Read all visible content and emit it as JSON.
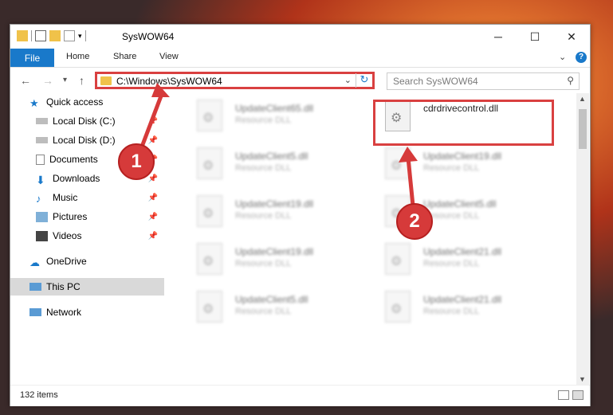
{
  "window": {
    "title": "SysWOW64"
  },
  "ribbon": {
    "file": "File",
    "tabs": [
      "Home",
      "Share",
      "View"
    ],
    "help": "?"
  },
  "nav": {
    "back": "←",
    "forward": "→",
    "recent": "▾",
    "up": "↑"
  },
  "address": {
    "path": "C:\\Windows\\SysWOW64",
    "dropdown": "⌄",
    "refresh": "↻"
  },
  "search": {
    "placeholder": "Search SysWOW64",
    "icon": "search-icon"
  },
  "sidebar": {
    "items": [
      {
        "label": "Quick access",
        "icon": "star-icon"
      },
      {
        "label": "Local Disk (C:)",
        "icon": "drive-icon",
        "pinned": true
      },
      {
        "label": "Local Disk (D:)",
        "icon": "drive-icon",
        "pinned": true
      },
      {
        "label": "Documents",
        "icon": "documents-icon",
        "pinned": true
      },
      {
        "label": "Downloads",
        "icon": "downloads-icon",
        "pinned": true
      },
      {
        "label": "Music",
        "icon": "music-icon",
        "pinned": true
      },
      {
        "label": "Pictures",
        "icon": "pictures-icon",
        "pinned": true
      },
      {
        "label": "Videos",
        "icon": "videos-icon",
        "pinned": true
      },
      {
        "label": "OneDrive",
        "icon": "cloud-icon"
      },
      {
        "label": "This PC",
        "icon": "computer-icon",
        "selected": true
      },
      {
        "label": "Network",
        "icon": "network-icon"
      }
    ]
  },
  "files": {
    "left_column": [
      {
        "name": "UpdateClient65.dll",
        "type": "Resource DLL"
      },
      {
        "name": "UpdateClient5.dll",
        "type": "Resource DLL"
      },
      {
        "name": "UpdateClient19.dll",
        "type": "Resource DLL"
      },
      {
        "name": "UpdateClient19.dll",
        "type": "Resource DLL"
      },
      {
        "name": "UpdateClient5.dll",
        "type": "Resource DLL"
      }
    ],
    "right_column": [
      {
        "name": "cdrdrivecontrol.dll",
        "type": ""
      },
      {
        "name": "UpdateClient19.dll",
        "type": "Resource DLL"
      },
      {
        "name": "UpdateClient5.dll",
        "type": "Resource DLL"
      },
      {
        "name": "UpdateClient21.dll",
        "type": "Resource DLL"
      },
      {
        "name": "UpdateClient21.dll",
        "type": "Resource DLL"
      }
    ]
  },
  "status": {
    "item_count": "132 items"
  },
  "markers": {
    "one": "1",
    "two": "2"
  },
  "colors": {
    "accent": "#1979ca",
    "highlight": "#d94040",
    "selected": "#d9d9d9"
  }
}
